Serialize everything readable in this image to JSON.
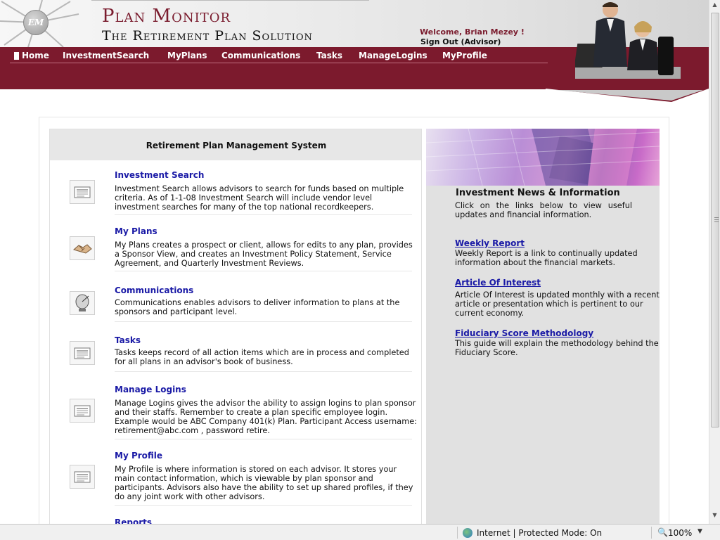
{
  "header": {
    "brand_title": "Plan Monitor",
    "brand_subtitle": "The Retirement Plan Solution",
    "logo_text": "EM",
    "welcome": "Welcome, Brian Mezey !",
    "sign_out": "Sign Out (Advisor)"
  },
  "nav": {
    "items": [
      {
        "label": "Home"
      },
      {
        "label": "InvestmentSearch"
      },
      {
        "label": "MyPlans"
      },
      {
        "label": "Communications"
      },
      {
        "label": "Tasks"
      },
      {
        "label": "ManageLogins"
      },
      {
        "label": "MyProfile"
      }
    ]
  },
  "left_panel": {
    "title": "Retirement Plan Management System",
    "features": [
      {
        "title": "Investment Search",
        "icon": "newspaper-icon",
        "desc": "Investment Search allows advisors to search for funds based on multiple criteria.  As of 1-1-08 Investment Search will include vendor level investment searches for many of the top national recordkeepers."
      },
      {
        "title": "My Plans",
        "icon": "handshake-icon",
        "desc": "My Plans creates a prospect or client, allows for edits to any plan, provides a Sponsor View, and creates an Investment Policy Statement, Service Agreement, and Quarterly Investment Reviews."
      },
      {
        "title": "Communications",
        "icon": "satellite-dish-icon",
        "desc": "Communications enables advisors to deliver information to plans at the sponsors and participant level."
      },
      {
        "title": "Tasks",
        "icon": "newspaper-icon",
        "desc": "Tasks keeps record of all action items which are in process and completed for all plans in an advisor's book of business."
      },
      {
        "title": "Manage Logins",
        "icon": "newspaper-icon",
        "desc": "Manage Logins gives the advisor the ability to assign logins to plan sponsor and their staffs.  Remember to create a plan specific employee login. Example would be ABC Company 401(k) Plan. Participant Access username: retirement@abc.com , password retire."
      },
      {
        "title": "My Profile",
        "icon": "newspaper-icon",
        "desc": "My Profile is where information is stored on each advisor. It stores your main contact information, which is viewable by plan sponsor and participants. Advisors also have the ability to set up shared profiles, if they do any joint work with other advisors."
      },
      {
        "title": "Reports",
        "icon": "newspaper-icon",
        "desc": ""
      }
    ]
  },
  "right_panel": {
    "title": "Investment News & Information",
    "intro": "Click on the links below to view useful updates and financial information.",
    "links": [
      {
        "label": "Weekly Report",
        "desc": "Weekly Report is a link to continually updated information about the financial markets."
      },
      {
        "label": "Article Of Interest",
        "desc": "Article Of Interest is updated monthly with a recent article or presentation which is pertinent to our current economy."
      },
      {
        "label": "Fiduciary Score Methodology",
        "desc": "This guide will explain the methodology behind the Fiduciary Score."
      }
    ]
  },
  "statusbar": {
    "zone": "Internet | Protected Mode: On",
    "zoom": "100%"
  },
  "colors": {
    "brand": "#7c1a2d",
    "link": "#1a1aa6",
    "panel_gray": "#e1e1e1"
  }
}
